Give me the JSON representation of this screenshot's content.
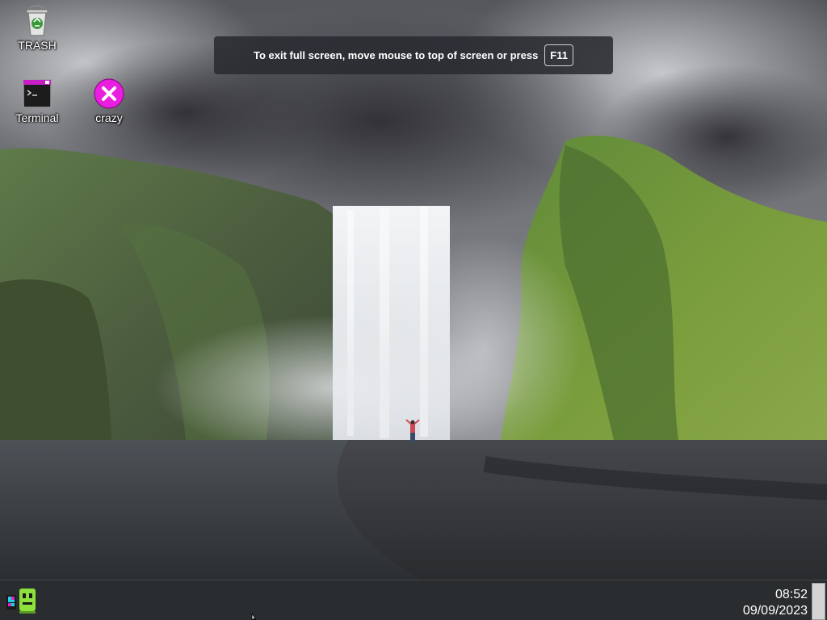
{
  "desktop": {
    "icons": [
      {
        "label": "TRASH",
        "icon": "trash-icon"
      },
      {
        "label": "Terminal",
        "icon": "terminal-icon"
      },
      {
        "label": "crazy",
        "icon": "close-circle-icon"
      }
    ]
  },
  "fullscreen_notice": {
    "message": "To exit full screen, move mouse to top of screen or press",
    "key": "F11"
  },
  "taskbar": {
    "start_icon": "app-launcher-icon",
    "clock": {
      "time": "08:52",
      "date": "09/09/2023"
    }
  },
  "colors": {
    "crazy_icon": "#e91ee0",
    "terminal_titlebar": "#c81ec8",
    "taskbar": "#181a1c"
  }
}
